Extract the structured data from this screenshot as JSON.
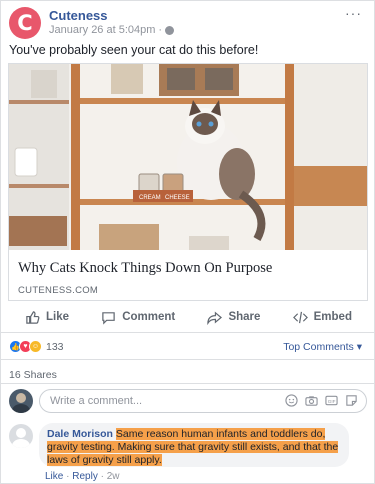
{
  "post": {
    "page_name": "Cuteness",
    "avatar_letter": "C",
    "timestamp": "January 26 at 5:04pm",
    "separator": "·",
    "more": "···",
    "status_text": "You've probably seen your cat do this before!"
  },
  "link_card": {
    "title": "Why Cats Knock Things Down On Purpose",
    "domain": "CUTENESS.COM",
    "photo_label_left": "CREAM",
    "photo_label_right": "CHEESE"
  },
  "actions": [
    {
      "label": "Like",
      "icon": "thumbs-up-icon"
    },
    {
      "label": "Comment",
      "icon": "comment-icon"
    },
    {
      "label": "Share",
      "icon": "share-arrow-icon"
    },
    {
      "label": "Embed",
      "icon": "code-icon"
    }
  ],
  "reactions": {
    "count": "133",
    "types": [
      "like",
      "love",
      "haha"
    ],
    "top_comments_label": "Top Comments ▾"
  },
  "shares_label": "16 Shares",
  "comment_input": {
    "placeholder": "Write a comment..."
  },
  "comment": {
    "author": "Dale Morison",
    "text": "Same reason human infants and toddlers do, gravity testing. Making sure that gravity still exists, and that the laws of gravity still apply.",
    "like_label": "Like",
    "reply_label": "Reply",
    "time": "2w",
    "dot": "·"
  },
  "colors": {
    "brand": "#e8576b",
    "link": "#365899",
    "highlight": "#f5a04a"
  }
}
